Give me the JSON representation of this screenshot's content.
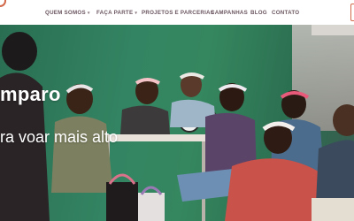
{
  "nav": {
    "items": [
      {
        "label": "QUEM SOMOS",
        "has_dropdown": true
      },
      {
        "label": "FAÇA PARTE",
        "has_dropdown": true
      },
      {
        "label": "PROJETOS E PARCERIAS",
        "has_dropdown": false
      },
      {
        "label": "CAMPANHAS",
        "has_dropdown": false
      },
      {
        "label": "BLOG",
        "has_dropdown": false
      },
      {
        "label": "CONTATO",
        "has_dropdown": false
      }
    ],
    "caret": "▾"
  },
  "hero": {
    "title": "mparo",
    "subtitle": "ra voar mais alto"
  },
  "colors": {
    "nav_text": "#6b5660",
    "accent": "#d2694a",
    "hero_green": "#338462"
  }
}
